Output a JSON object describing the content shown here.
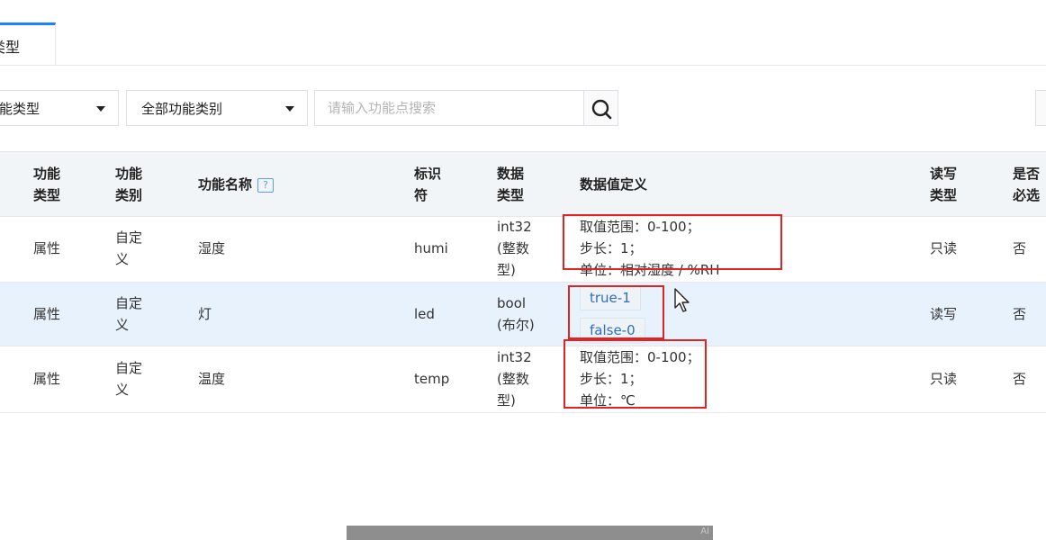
{
  "tabs": {
    "active_label": "类型"
  },
  "filters": {
    "type_select": "能类型",
    "category_select": "全部功能类别",
    "search_placeholder": "请输入功能点搜索"
  },
  "table": {
    "headers": {
      "func_type": [
        "功能",
        "类型"
      ],
      "func_category": [
        "功能",
        "类别"
      ],
      "func_name": "功能名称",
      "identifier": [
        "标识",
        "符"
      ],
      "data_type": [
        "数据",
        "类型"
      ],
      "value_def": "数据值定义",
      "rw_type": [
        "读写",
        "类型"
      ],
      "required": [
        "是否",
        "必选"
      ]
    },
    "help_icon_glyph": "?",
    "rows": [
      {
        "func_type": "属性",
        "func_category": [
          "自定",
          "义"
        ],
        "func_name": "湿度",
        "identifier": "humi",
        "data_type": [
          "int32",
          "(整数",
          "型)"
        ],
        "value_def": [
          "取值范围：0-100；",
          "步长：1；",
          "单位：相对湿度 / %RH"
        ],
        "rw_type": "只读",
        "required": "否"
      },
      {
        "func_type": "属性",
        "func_category": [
          "自定",
          "义"
        ],
        "func_name": "灯",
        "identifier": "led",
        "data_type": [
          "bool",
          "(布尔)"
        ],
        "value_tags": [
          "true-1",
          "false-0"
        ],
        "rw_type": "读写",
        "required": "否"
      },
      {
        "func_type": "属性",
        "func_category": [
          "自定",
          "义"
        ],
        "func_name": "温度",
        "identifier": "temp",
        "data_type": [
          "int32",
          "(整数",
          "型)"
        ],
        "value_def": [
          "取值范围：0-100；",
          "步长：1；",
          "单位：℃"
        ],
        "rw_type": "只读",
        "required": "否"
      }
    ]
  },
  "overlay": {
    "badge": "AI"
  },
  "colors": {
    "accent": "#1e80ff",
    "annotation_red": "#e02424",
    "row_highlight": "#e8f2fd"
  }
}
